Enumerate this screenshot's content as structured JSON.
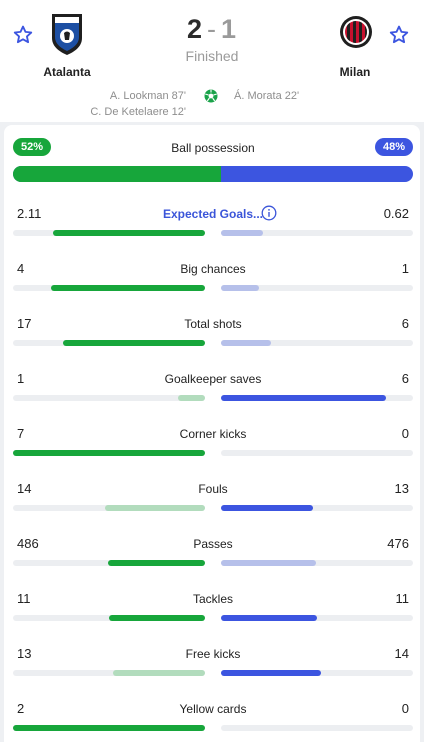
{
  "match": {
    "home_team": "Atalanta",
    "away_team": "Milan",
    "home_score": "2",
    "separator": "-",
    "away_score": "1",
    "status": "Finished",
    "home_scorers": [
      "A. Lookman 87'",
      "C. De Ketelaere 12'"
    ],
    "away_scorers": [
      "Á. Morata 22'"
    ]
  },
  "colors": {
    "home": "#17a63b",
    "home_weak": "#b2dcbd",
    "away": "#3c55e0",
    "away_weak": "#b6c0ea",
    "link": "#3b55d9"
  },
  "icons": {
    "favorite_home": "star-outline-icon",
    "favorite_away": "star-outline-icon",
    "goal": "soccer-ball-icon",
    "info": "info-icon"
  },
  "possession": {
    "label": "Ball possession",
    "home": "52%",
    "away": "48%",
    "home_value": 52,
    "away_value": 48
  },
  "stats": [
    {
      "label": "Expected Goals...",
      "home": "2.11",
      "away": "0.62",
      "link": true,
      "info": true,
      "home_fill": 0.79,
      "away_fill": 0.22,
      "home_strong": true,
      "away_strong": false
    },
    {
      "label": "Big chances",
      "home": "4",
      "away": "1",
      "home_fill": 0.8,
      "away_fill": 0.2,
      "home_strong": true,
      "away_strong": false
    },
    {
      "label": "Total shots",
      "home": "17",
      "away": "6",
      "home_fill": 0.74,
      "away_fill": 0.26,
      "home_strong": true,
      "away_strong": false
    },
    {
      "label": "Goalkeeper saves",
      "home": "1",
      "away": "6",
      "home_fill": 0.14,
      "away_fill": 0.86,
      "home_strong": false,
      "away_strong": true
    },
    {
      "label": "Corner kicks",
      "home": "7",
      "away": "0",
      "home_fill": 1.0,
      "away_fill": 0.0,
      "home_strong": true,
      "away_strong": false
    },
    {
      "label": "Fouls",
      "home": "14",
      "away": "13",
      "home_fill": 0.52,
      "away_fill": 0.48,
      "home_strong": false,
      "away_strong": true
    },
    {
      "label": "Passes",
      "home": "486",
      "away": "476",
      "home_fill": 0.505,
      "away_fill": 0.495,
      "home_strong": true,
      "away_strong": false
    },
    {
      "label": "Tackles",
      "home": "11",
      "away": "11",
      "home_fill": 0.5,
      "away_fill": 0.5,
      "home_strong": true,
      "away_strong": true
    },
    {
      "label": "Free kicks",
      "home": "13",
      "away": "14",
      "home_fill": 0.48,
      "away_fill": 0.52,
      "home_strong": false,
      "away_strong": true
    },
    {
      "label": "Yellow cards",
      "home": "2",
      "away": "0",
      "home_fill": 1.0,
      "away_fill": 0.0,
      "home_strong": true,
      "away_strong": false
    }
  ]
}
